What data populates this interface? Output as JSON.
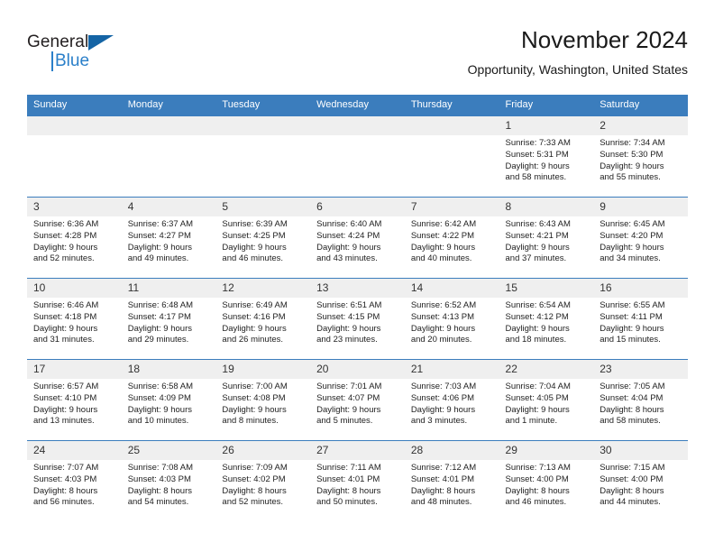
{
  "brand": {
    "name_dark": "General",
    "name_blue": "Blue",
    "accent_color": "#2a7fc9",
    "triangle_color": "#1464a5"
  },
  "header": {
    "title": "November 2024",
    "subtitle": "Opportunity, Washington, United States"
  },
  "calendar": {
    "header_bg": "#3b7dbd",
    "daynum_bg": "#efefef",
    "weekday_headers": [
      "Sunday",
      "Monday",
      "Tuesday",
      "Wednesday",
      "Thursday",
      "Friday",
      "Saturday"
    ],
    "weeks": [
      [
        {
          "day": "",
          "lines": []
        },
        {
          "day": "",
          "lines": []
        },
        {
          "day": "",
          "lines": []
        },
        {
          "day": "",
          "lines": []
        },
        {
          "day": "",
          "lines": []
        },
        {
          "day": "1",
          "lines": [
            "Sunrise: 7:33 AM",
            "Sunset: 5:31 PM",
            "Daylight: 9 hours",
            "and 58 minutes."
          ]
        },
        {
          "day": "2",
          "lines": [
            "Sunrise: 7:34 AM",
            "Sunset: 5:30 PM",
            "Daylight: 9 hours",
            "and 55 minutes."
          ]
        }
      ],
      [
        {
          "day": "3",
          "lines": [
            "Sunrise: 6:36 AM",
            "Sunset: 4:28 PM",
            "Daylight: 9 hours",
            "and 52 minutes."
          ]
        },
        {
          "day": "4",
          "lines": [
            "Sunrise: 6:37 AM",
            "Sunset: 4:27 PM",
            "Daylight: 9 hours",
            "and 49 minutes."
          ]
        },
        {
          "day": "5",
          "lines": [
            "Sunrise: 6:39 AM",
            "Sunset: 4:25 PM",
            "Daylight: 9 hours",
            "and 46 minutes."
          ]
        },
        {
          "day": "6",
          "lines": [
            "Sunrise: 6:40 AM",
            "Sunset: 4:24 PM",
            "Daylight: 9 hours",
            "and 43 minutes."
          ]
        },
        {
          "day": "7",
          "lines": [
            "Sunrise: 6:42 AM",
            "Sunset: 4:22 PM",
            "Daylight: 9 hours",
            "and 40 minutes."
          ]
        },
        {
          "day": "8",
          "lines": [
            "Sunrise: 6:43 AM",
            "Sunset: 4:21 PM",
            "Daylight: 9 hours",
            "and 37 minutes."
          ]
        },
        {
          "day": "9",
          "lines": [
            "Sunrise: 6:45 AM",
            "Sunset: 4:20 PM",
            "Daylight: 9 hours",
            "and 34 minutes."
          ]
        }
      ],
      [
        {
          "day": "10",
          "lines": [
            "Sunrise: 6:46 AM",
            "Sunset: 4:18 PM",
            "Daylight: 9 hours",
            "and 31 minutes."
          ]
        },
        {
          "day": "11",
          "lines": [
            "Sunrise: 6:48 AM",
            "Sunset: 4:17 PM",
            "Daylight: 9 hours",
            "and 29 minutes."
          ]
        },
        {
          "day": "12",
          "lines": [
            "Sunrise: 6:49 AM",
            "Sunset: 4:16 PM",
            "Daylight: 9 hours",
            "and 26 minutes."
          ]
        },
        {
          "day": "13",
          "lines": [
            "Sunrise: 6:51 AM",
            "Sunset: 4:15 PM",
            "Daylight: 9 hours",
            "and 23 minutes."
          ]
        },
        {
          "day": "14",
          "lines": [
            "Sunrise: 6:52 AM",
            "Sunset: 4:13 PM",
            "Daylight: 9 hours",
            "and 20 minutes."
          ]
        },
        {
          "day": "15",
          "lines": [
            "Sunrise: 6:54 AM",
            "Sunset: 4:12 PM",
            "Daylight: 9 hours",
            "and 18 minutes."
          ]
        },
        {
          "day": "16",
          "lines": [
            "Sunrise: 6:55 AM",
            "Sunset: 4:11 PM",
            "Daylight: 9 hours",
            "and 15 minutes."
          ]
        }
      ],
      [
        {
          "day": "17",
          "lines": [
            "Sunrise: 6:57 AM",
            "Sunset: 4:10 PM",
            "Daylight: 9 hours",
            "and 13 minutes."
          ]
        },
        {
          "day": "18",
          "lines": [
            "Sunrise: 6:58 AM",
            "Sunset: 4:09 PM",
            "Daylight: 9 hours",
            "and 10 minutes."
          ]
        },
        {
          "day": "19",
          "lines": [
            "Sunrise: 7:00 AM",
            "Sunset: 4:08 PM",
            "Daylight: 9 hours",
            "and 8 minutes."
          ]
        },
        {
          "day": "20",
          "lines": [
            "Sunrise: 7:01 AM",
            "Sunset: 4:07 PM",
            "Daylight: 9 hours",
            "and 5 minutes."
          ]
        },
        {
          "day": "21",
          "lines": [
            "Sunrise: 7:03 AM",
            "Sunset: 4:06 PM",
            "Daylight: 9 hours",
            "and 3 minutes."
          ]
        },
        {
          "day": "22",
          "lines": [
            "Sunrise: 7:04 AM",
            "Sunset: 4:05 PM",
            "Daylight: 9 hours",
            "and 1 minute."
          ]
        },
        {
          "day": "23",
          "lines": [
            "Sunrise: 7:05 AM",
            "Sunset: 4:04 PM",
            "Daylight: 8 hours",
            "and 58 minutes."
          ]
        }
      ],
      [
        {
          "day": "24",
          "lines": [
            "Sunrise: 7:07 AM",
            "Sunset: 4:03 PM",
            "Daylight: 8 hours",
            "and 56 minutes."
          ]
        },
        {
          "day": "25",
          "lines": [
            "Sunrise: 7:08 AM",
            "Sunset: 4:03 PM",
            "Daylight: 8 hours",
            "and 54 minutes."
          ]
        },
        {
          "day": "26",
          "lines": [
            "Sunrise: 7:09 AM",
            "Sunset: 4:02 PM",
            "Daylight: 8 hours",
            "and 52 minutes."
          ]
        },
        {
          "day": "27",
          "lines": [
            "Sunrise: 7:11 AM",
            "Sunset: 4:01 PM",
            "Daylight: 8 hours",
            "and 50 minutes."
          ]
        },
        {
          "day": "28",
          "lines": [
            "Sunrise: 7:12 AM",
            "Sunset: 4:01 PM",
            "Daylight: 8 hours",
            "and 48 minutes."
          ]
        },
        {
          "day": "29",
          "lines": [
            "Sunrise: 7:13 AM",
            "Sunset: 4:00 PM",
            "Daylight: 8 hours",
            "and 46 minutes."
          ]
        },
        {
          "day": "30",
          "lines": [
            "Sunrise: 7:15 AM",
            "Sunset: 4:00 PM",
            "Daylight: 8 hours",
            "and 44 minutes."
          ]
        }
      ]
    ]
  }
}
